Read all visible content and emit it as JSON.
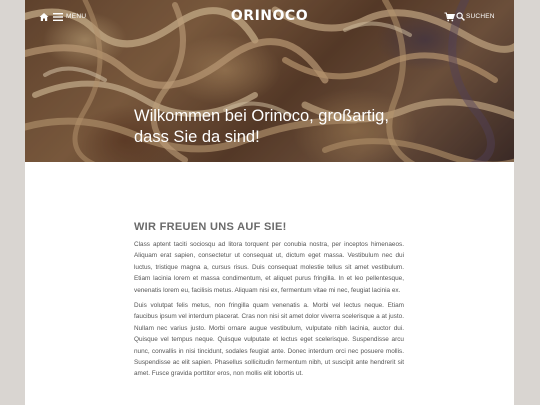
{
  "topbar": {
    "home_icon": "home-icon",
    "menu_icon": "hamburger-icon",
    "menu_label": "MENU",
    "logo": "ORINOCO",
    "cart_icon": "cart-icon",
    "search_icon": "search-icon",
    "search_label": "SUCHEN"
  },
  "hero": {
    "title": "Wilkommen bei Orinoco, großartig, dass Sie da sind!"
  },
  "main": {
    "heading": "WIR FREUEN UNS AUF SIE!",
    "paragraphs": [
      "Class aptent taciti sociosqu ad litora torquent per conubia nostra, per inceptos himenaeos. Aliquam erat sapien, consectetur ut consequat ut, dictum eget massa. Vestibulum nec dui luctus, tristique magna a, cursus risus. Duis consequat molestie tellus sit amet vestibulum. Etiam lacinia lorem et massa condimentum, et aliquet purus fringilla. In et leo pellentesque, venenatis lorem eu, facilisis metus. Aliquam nisi ex, fermentum vitae mi nec, feugiat lacinia ex.",
      "Duis volutpat felis metus, non fringilla quam venenatis a. Morbi vel lectus neque. Etiam faucibus ipsum vel interdum placerat. Cras non nisi sit amet dolor viverra scelerisque a at justo. Nullam nec varius justo. Morbi ornare augue vestibulum, vulputate nibh lacinia, auctor dui. Quisque vel tempus neque. Quisque vulputate et lectus eget scelerisque. Suspendisse arcu nunc, convallis in nisi tincidunt, sodales feugiat ante. Donec interdum orci nec posuere mollis. Suspendisse ac elit sapien. Phasellus sollicitudin fermentum nibh, ut suscipit ante hendrerit sit amet. Fusce gravida porttitor eros, non mollis elit lobortis ut."
    ]
  },
  "colors": {
    "background": "#d9d5d1",
    "heading": "#6a6a6a",
    "text": "#555555"
  }
}
